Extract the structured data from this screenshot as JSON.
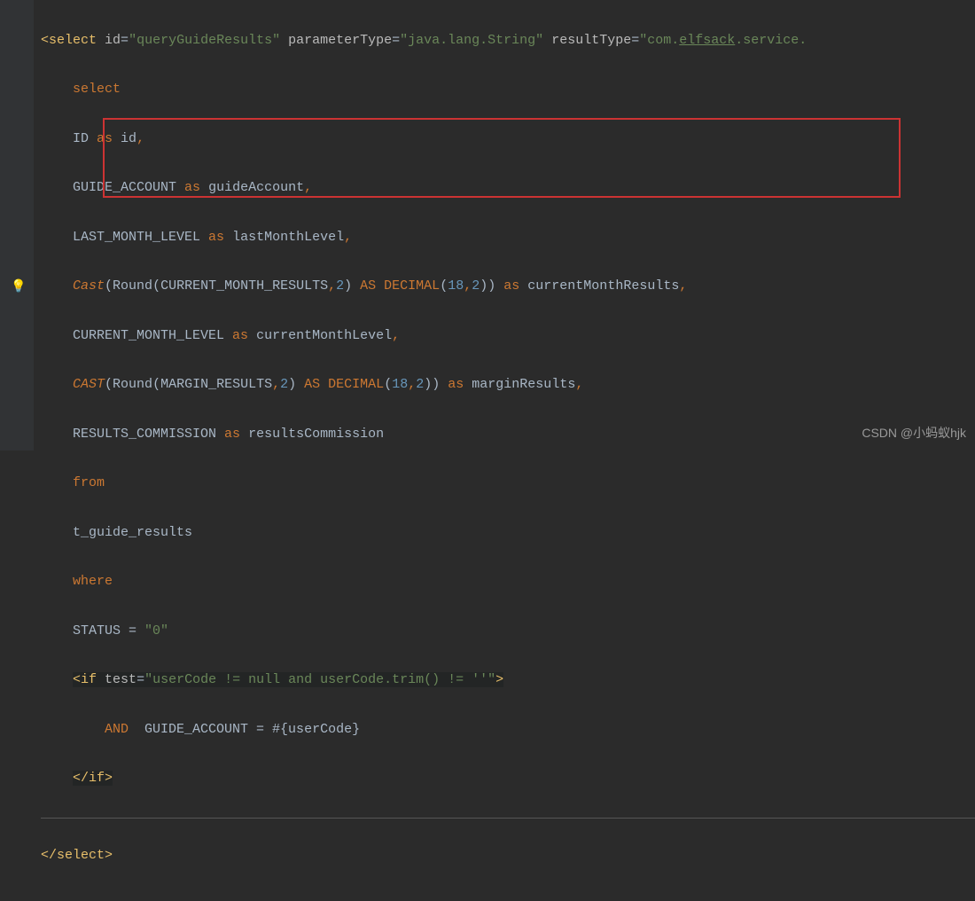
{
  "code": {
    "select_tag_open": "<select",
    "attr_id_name": "id",
    "attr_id_val": "\"queryGuideResults\"",
    "attr_param_name": "parameterType",
    "attr_param_val": "\"java.lang.String\"",
    "attr_result_name": "resultType",
    "attr_result_val_pre": "\"com.",
    "attr_result_val_elfsack": "elfsack",
    "attr_result_val_post": ".service.",
    "line_select": "select",
    "line_id_col": "ID ",
    "line_id_as": "as",
    "line_id_alias": " id",
    "line_guide_col": "GUIDE_ACCOUNT ",
    "line_guide_as": "as",
    "line_guide_alias": " guideAccount",
    "line_last_col": "LAST_MONTH_LEVEL ",
    "line_last_as": "as",
    "line_last_alias": " lastMonthLevel",
    "cast1_cast": "Cast",
    "cast1_round": "Round",
    "cast1_col": "CURRENT_MONTH_RESULTS",
    "cast1_prec": "2",
    "cast1_as_dec": "AS DECIMAL",
    "cast1_d1": "18",
    "cast1_d2": "2",
    "cast1_as": "as",
    "cast1_alias": " currentMonthResults",
    "line_curlvl_col": "CURRENT_MONTH_LEVEL ",
    "line_curlvl_as": "as",
    "line_curlvl_alias": " currentMonthLevel",
    "cast2_cast": "CAST",
    "cast2_round": "Round",
    "cast2_col": "MARGIN_RESULTS",
    "cast2_prec": "2",
    "cast2_as_dec": "AS DECIMAL",
    "cast2_d1": "18",
    "cast2_d2": "2",
    "cast2_as": "as",
    "cast2_alias": " marginResults",
    "line_res_col": "RESULTS_COMMISSION ",
    "line_res_as": "as",
    "line_res_alias": " resultsCommission",
    "line_from": "from",
    "line_table": "t_guide_results",
    "line_where": "where",
    "line_status": "STATUS = ",
    "line_status_val": "\"0\"",
    "if_open": "<if",
    "if_test_name": "test",
    "if_test_val": "\"userCode != null and userCode.trim() != ''\"",
    "if_close_bracket": ">",
    "and_kw": "AND",
    "and_body": "  GUIDE_ACCOUNT = #{userCode}",
    "if_close": "</if>",
    "select_close": "</select>"
  },
  "watermark": "CSDN @小蚂蚁hjk"
}
